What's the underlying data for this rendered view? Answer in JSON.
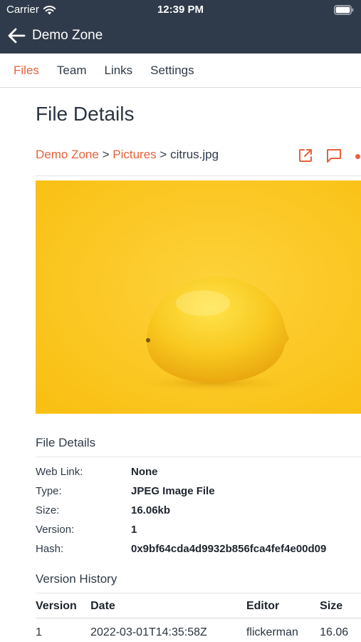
{
  "status_bar": {
    "carrier": "Carrier",
    "time": "12:39 PM"
  },
  "nav": {
    "title": "Demo Zone"
  },
  "tabs": [
    {
      "label": "Files",
      "active": true
    },
    {
      "label": "Team",
      "active": false
    },
    {
      "label": "Links",
      "active": false
    },
    {
      "label": "Settings",
      "active": false
    }
  ],
  "page": {
    "title": "File Details"
  },
  "breadcrumb": {
    "zone": "Demo Zone",
    "sep1": ">",
    "folder": "Pictures",
    "sep2": ">",
    "file": "citrus.jpg"
  },
  "actions": {
    "icons": [
      "open-external-icon",
      "comment-icon",
      "more-icon"
    ]
  },
  "file_details": {
    "heading": "File Details",
    "rows": [
      {
        "label": "Web Link:",
        "value": "None"
      },
      {
        "label": "Type:",
        "value": "JPEG Image File"
      },
      {
        "label": "Size:",
        "value": "16.06kb"
      },
      {
        "label": "Version:",
        "value": "1"
      },
      {
        "label": "Hash:",
        "value": "0x9bf64cda4d9932b856fca4fef4e00d09"
      }
    ]
  },
  "version_history": {
    "heading": "Version History",
    "columns": [
      "Version",
      "Date",
      "Editor",
      "Size"
    ],
    "rows": [
      [
        "1",
        "2022-03-01T14:35:58Z",
        "flickerman",
        "16.06"
      ]
    ]
  },
  "colors": {
    "accent": "#e8613b",
    "header_bg": "#2f3b4a",
    "image_bg": "#fbc61c",
    "lemon": "#f6c21c"
  }
}
